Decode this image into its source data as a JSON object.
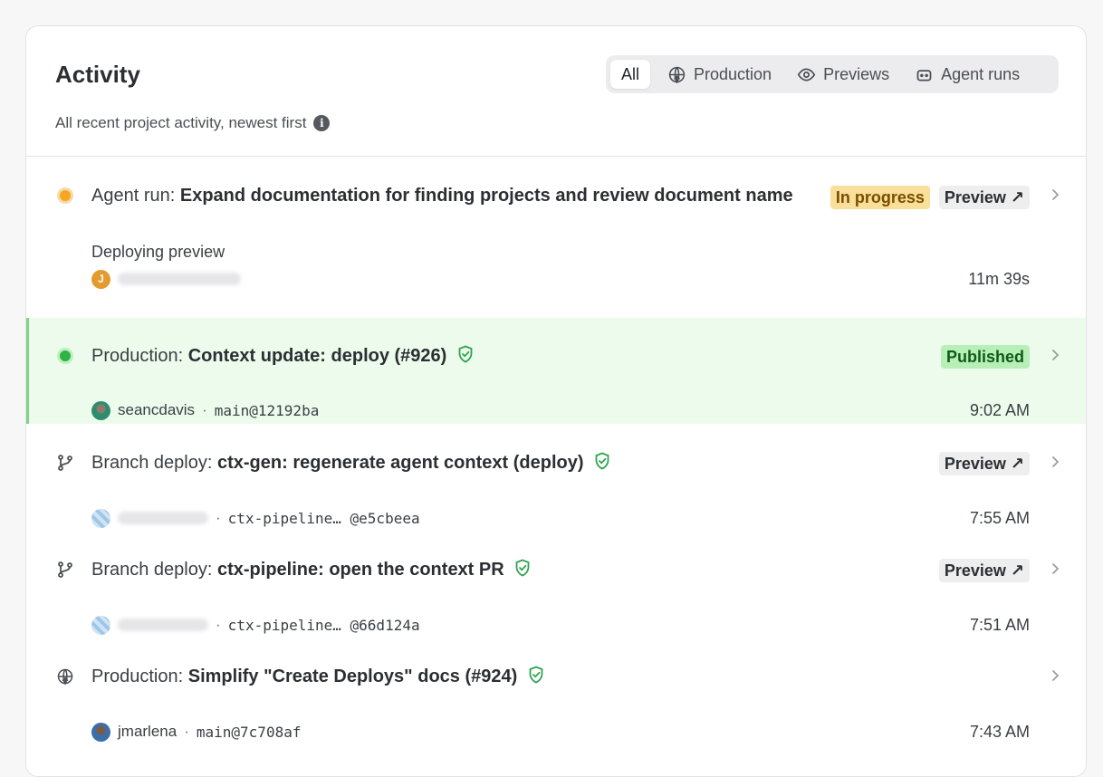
{
  "header": {
    "title": "Activity",
    "subtitle": "All recent project activity, newest first",
    "info_icon": "i"
  },
  "filters": [
    {
      "label": "All",
      "icon": null,
      "active": true
    },
    {
      "label": "Production",
      "icon": "globe-upload-icon",
      "active": false
    },
    {
      "label": "Previews",
      "icon": "eye-icon",
      "active": false
    },
    {
      "label": "Agent runs",
      "icon": "robot-icon",
      "active": false
    }
  ],
  "activity": [
    {
      "kind": "Agent run:",
      "name": "Expand documentation for finding projects and review document name",
      "subtext": "Deploying preview",
      "avatar_initial": "J",
      "status": "In progress",
      "preview_label": "Preview ↗",
      "time": "11m 39s",
      "status_icon": "in-progress-dot-icon"
    },
    {
      "kind": "Production:",
      "name": "Context update: deploy (#926)",
      "user": "seancdavis",
      "ref": "main@12192ba",
      "status": "Published",
      "time": "9:02 AM",
      "status_icon": "published-dot-icon"
    },
    {
      "kind": "Branch deploy:",
      "name": "ctx-gen: regenerate agent context (deploy)",
      "ref": "ctx-pipeline… @e5cbeea",
      "preview_label": "Preview ↗",
      "time": "7:55 AM",
      "status_icon": "branch-icon"
    },
    {
      "kind": "Branch deploy:",
      "name": "ctx-pipeline: open the context PR",
      "ref": "ctx-pipeline… @66d124a",
      "preview_label": "Preview ↗",
      "time": "7:51 AM",
      "status_icon": "branch-icon"
    },
    {
      "kind": "Production:",
      "name": "Simplify \"Create Deploys\" docs (#924)",
      "user": "jmarlena",
      "ref": "main@7c708af",
      "time": "7:43 AM",
      "status_icon": "globe-upload-icon"
    }
  ],
  "colors": {
    "in_progress_bg": "#f8df9a",
    "published_bg": "#b8efb9",
    "highlight_row": "#ecfbec",
    "shield_green": "#2ea44f"
  }
}
